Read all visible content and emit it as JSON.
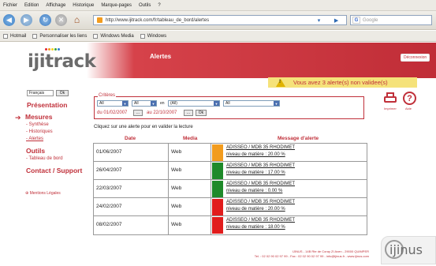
{
  "browser": {
    "menu": [
      "Fichier",
      "Edition",
      "Affichage",
      "Historique",
      "Marque-pages",
      "Outils",
      "?"
    ],
    "url": "http://www.ijitrack.com/fr/tableau_de_bord/alertes",
    "search_placeholder": "Google",
    "bookmarks": [
      "Hotmail",
      "Personnaliser les liens",
      "Windows Media",
      "Windows"
    ]
  },
  "header": {
    "logo": "ijitrack",
    "title": "Alertes",
    "logout": "Déconnexion"
  },
  "sidebar": {
    "language": "Français",
    "language_ok": "Ok",
    "presentation": "Présentation",
    "mesures": "Mesures",
    "mesures_items": [
      "- Synthèse",
      "- Historiques",
      "- Alertes"
    ],
    "outils": "Outils",
    "outils_items": [
      "- Tableau de bord"
    ],
    "contact": "Contact / Support",
    "legal": "Mentions Légales"
  },
  "alert_banner": {
    "text": "Vous avez 3 alerte(s) non validee(s)"
  },
  "criteria": {
    "legend": "Critères",
    "select1": "All",
    "select2": "All",
    "select_sep": "en",
    "select3": "(All)",
    "select4": "All",
    "date_from_label": "du 01/02/2007",
    "date_to_label": "au 22/10/2007",
    "cal1": "...",
    "cal2": "...",
    "ok": "Ok"
  },
  "tools": {
    "print_label": "Imprimer",
    "help_label": "Aide"
  },
  "instruction": "Cliquez sur une alerte pour en valider la lecture",
  "table": {
    "headers": [
      "Date",
      "Media",
      "Message d'alerte"
    ],
    "rows": [
      {
        "date": "01/06/2007",
        "media": "Web",
        "color": "#f29c1f",
        "line1": "ADISSEO / MDB 35 RHODIMET",
        "line2": "niveau de matière : 20.00 %"
      },
      {
        "date": "26/04/2007",
        "media": "Web",
        "color": "#1f8a2a",
        "line1": "ADISSEO / MDB 35 RHODIMET",
        "line2": "niveau de matière : 17.00 %"
      },
      {
        "date": "22/03/2007",
        "media": "Web",
        "color": "#1f8a2a",
        "line1": "ADISSEO / MDB 35 RHODIMET",
        "line2": "niveau de matière : 0.00 %"
      },
      {
        "date": "24/02/2007",
        "media": "Web",
        "color": "#e11d1d",
        "line1": "ADISSEO / MDB 35 RHODIMET",
        "line2": "niveau de matière : 20.00 %"
      },
      {
        "date": "08/02/2007",
        "media": "Web",
        "color": "#e11d1d",
        "line1": "ADISSEO / MDB 35 RHODIMET",
        "line2": "niveau de matière : 18.00 %"
      }
    ]
  },
  "footer": {
    "line1": "IJINUS - 14B Rte de Coray ZI Aven - 29000 QUIMPER",
    "line2": "Tel. : 02 02 90 02 97 99 - Fax : 02 02 90 02 97 99 - info@ijinus.fr - www.ijinus.com"
  },
  "brand": {
    "ijinus": "ijinus",
    "accent": "#c0303a"
  }
}
